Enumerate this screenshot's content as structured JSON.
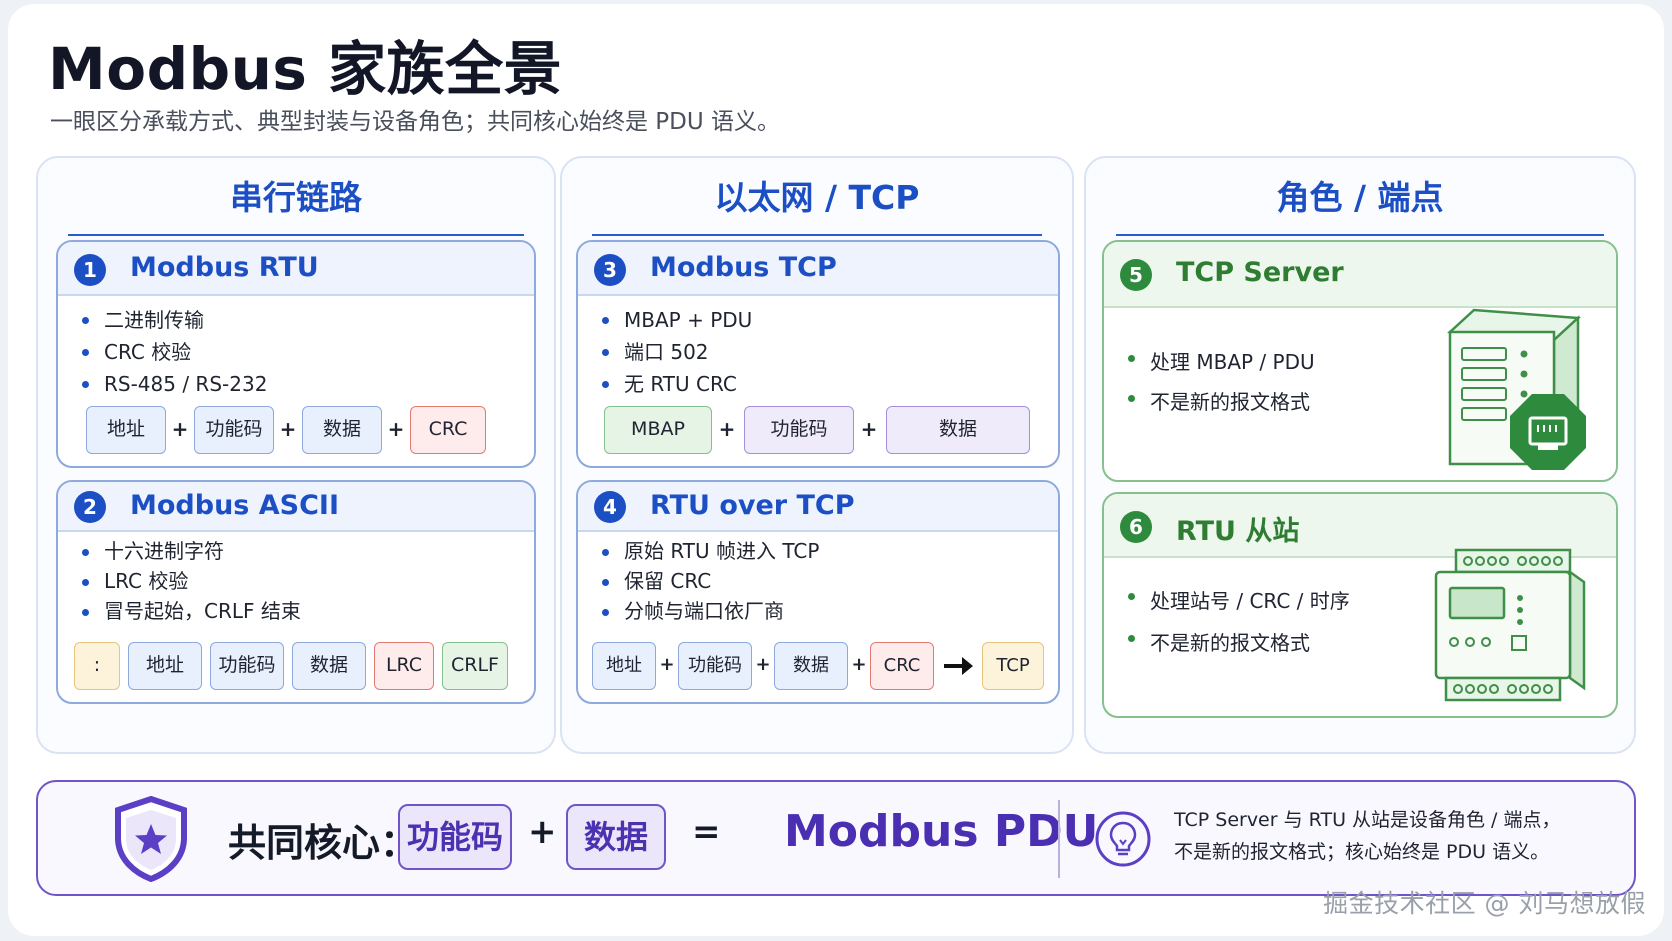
{
  "title": "Modbus 家族全景",
  "subtitle": "一眼区分承载方式、典型封装与设备角色；共同核心始终是 PDU 语义。",
  "columns": [
    {
      "title": "串行链路"
    },
    {
      "title": "以太网 / TCP"
    },
    {
      "title": "角色 / 端点"
    }
  ],
  "cards": {
    "rtu": {
      "num": "1",
      "title": "Modbus RTU",
      "bullets": [
        "二进制传输",
        "CRC 校验",
        "RS-485 / RS-232"
      ],
      "frame": [
        "地址",
        "功能码",
        "数据",
        "CRC"
      ]
    },
    "ascii": {
      "num": "2",
      "title": "Modbus ASCII",
      "bullets": [
        "十六进制字符",
        "LRC 校验",
        "冒号起始，CRLF 结束"
      ],
      "frame": [
        ":",
        "地址",
        "功能码",
        "数据",
        "LRC",
        "CRLF"
      ]
    },
    "tcp": {
      "num": "3",
      "title": "Modbus TCP",
      "bullets": [
        "MBAP + PDU",
        "端口 502",
        "无 RTU CRC"
      ],
      "frame": [
        "MBAP",
        "功能码",
        "数据"
      ]
    },
    "rtu_over_tcp": {
      "num": "4",
      "title": "RTU over TCP",
      "bullets": [
        "原始 RTU 帧进入 TCP",
        "保留 CRC",
        "分帧与端口依厂商"
      ],
      "frame": [
        "地址",
        "功能码",
        "数据",
        "CRC",
        "TCP"
      ]
    },
    "server": {
      "num": "5",
      "title": "TCP Server",
      "bullets": [
        "处理 MBAP / PDU",
        "不是新的报文格式"
      ]
    },
    "slave": {
      "num": "6",
      "title": "RTU 从站",
      "bullets": [
        "处理站号 / CRC / 时序",
        "不是新的报文格式"
      ]
    }
  },
  "symbols": {
    "plus": "+",
    "equals": "="
  },
  "core": {
    "label": "共同核心：",
    "part1": "功能码",
    "part2": "数据",
    "result": "Modbus PDU",
    "note_line1": "TCP Server 与 RTU 从站是设备角色 / 端点，",
    "note_line2": "不是新的报文格式；核心始终是 PDU 语义。"
  },
  "watermark": "掘金技术社区 @ 刘马想放假",
  "colors": {
    "accent_blue": "#1c4fc4",
    "accent_green": "#2e8b3d",
    "accent_purple": "#4b2fb3",
    "crc_red": "#e27a72"
  },
  "icons": [
    "shield-star-icon",
    "lightbulb-icon",
    "server-icon",
    "ethernet-port-icon",
    "din-rail-device-icon",
    "arrow-right-icon"
  ]
}
